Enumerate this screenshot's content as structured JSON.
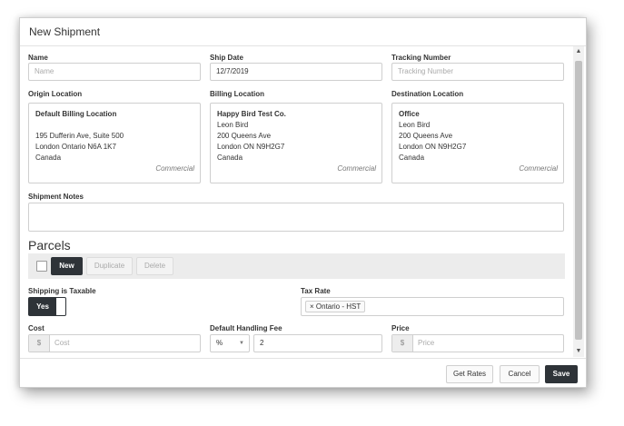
{
  "dialog": {
    "title": "New Shipment"
  },
  "fields": {
    "name": {
      "label": "Name",
      "placeholder": "Name"
    },
    "ship_date": {
      "label": "Ship Date",
      "value": "12/7/2019"
    },
    "tracking": {
      "label": "Tracking Number",
      "placeholder": "Tracking Number"
    }
  },
  "locations": {
    "origin": {
      "label": "Origin Location",
      "name": "Default Billing Location",
      "lines": [
        "",
        "195 Dufferin Ave, Suite 500",
        "London Ontario N6A 1K7",
        "Canada"
      ],
      "kind": "Commercial"
    },
    "billing": {
      "label": "Billing Location",
      "name": "Happy Bird Test Co.",
      "lines": [
        "Leon Bird",
        "200 Queens Ave",
        "London ON N9H2G7",
        "Canada"
      ],
      "kind": "Commercial"
    },
    "destination": {
      "label": "Destination Location",
      "name": "Office",
      "lines": [
        "Leon Bird",
        "200 Queens Ave",
        "London ON N9H2G7",
        "Canada"
      ],
      "kind": "Commercial"
    }
  },
  "notes": {
    "label": "Shipment Notes",
    "value": ""
  },
  "parcels": {
    "title": "Parcels",
    "new": "New",
    "duplicate": "Duplicate",
    "delete": "Delete"
  },
  "taxable": {
    "label": "Shipping is Taxable",
    "toggle": "Yes"
  },
  "tax_rate": {
    "label": "Tax Rate",
    "tag": "× Ontario - HST"
  },
  "cost": {
    "label": "Cost",
    "addon": "$",
    "placeholder": "Cost"
  },
  "handling": {
    "label": "Default Handling Fee",
    "unit": "%",
    "value": "2"
  },
  "price": {
    "label": "Price",
    "addon": "$",
    "placeholder": "Price"
  },
  "footer": {
    "get_rates": "Get Rates",
    "cancel": "Cancel",
    "save": "Save"
  },
  "colors": {
    "dark_button": "#2e3338",
    "toolbar_bg": "#ececec"
  }
}
